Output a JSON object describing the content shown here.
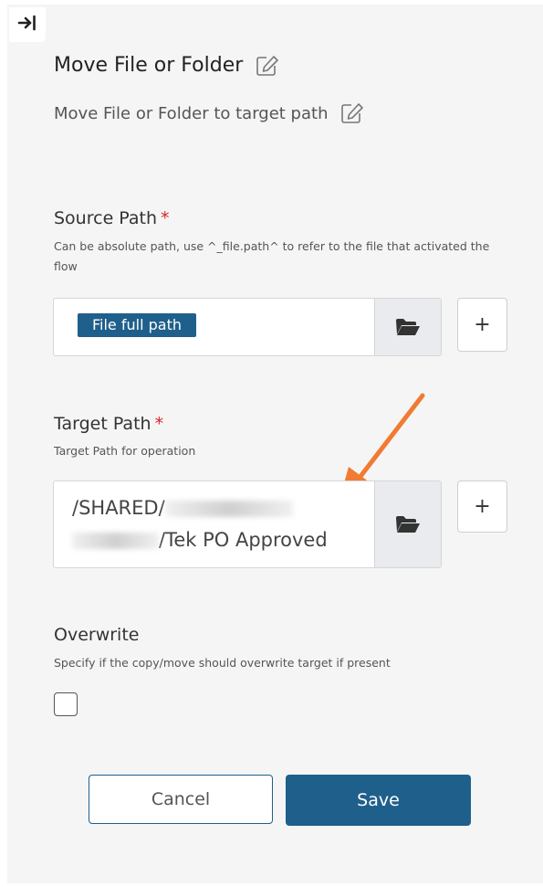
{
  "header": {
    "title": "Move File or Folder",
    "subtitle": "Move File or Folder to target path"
  },
  "source_path": {
    "label": "Source Path",
    "required_mark": "*",
    "help": "Can be absolute path, use ^_file.path^ to refer to the file that activated the flow",
    "chip": "File full path"
  },
  "target_path": {
    "label": "Target Path",
    "required_mark": "*",
    "help": "Target Path for operation",
    "line1_visible": "/SHARED/",
    "line2_visible": "/Tek PO Approved"
  },
  "overwrite": {
    "label": "Overwrite",
    "help": "Specify if the copy/move should overwrite target if present",
    "checked": false
  },
  "actions": {
    "plus_label": "+",
    "cancel_label": "Cancel",
    "save_label": "Save"
  },
  "colors": {
    "accent": "#1f5f8b",
    "required": "#d8232a",
    "annotation_arrow": "#f07b32"
  },
  "icons": [
    "collapse-panel-icon",
    "edit-icon",
    "folder-open-icon"
  ]
}
